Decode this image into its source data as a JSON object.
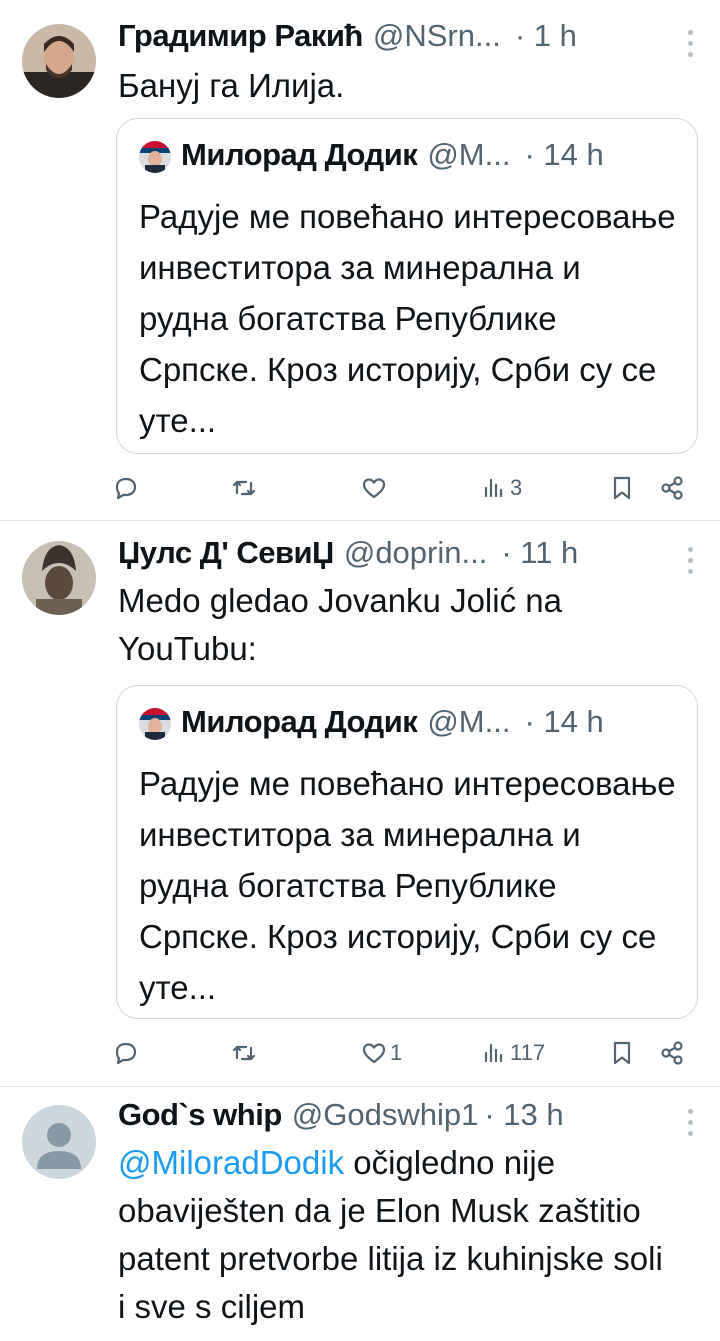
{
  "tweets": [
    {
      "name": "Градимир Ракић",
      "handle": "@NSrn...",
      "time": "· 1 h",
      "text": "Бануј га Илија.",
      "quote": {
        "name": "Милорад Додик",
        "handle": "@M...",
        "time": "· 14 h",
        "text": "Радује ме повећано интересовање инвеститора за минерална и рудна богатства Републике Српске. Кроз историју, Срби су се уте..."
      },
      "stats": {
        "replies": "",
        "retweets": "",
        "likes": "",
        "views": "3"
      }
    },
    {
      "name": "Џулс Д' СевиЏ",
      "handle": "@doprin...",
      "time": "· 11 h",
      "text": "Medo gledao Jovanku Jolić na YouTubu:",
      "quote": {
        "name": "Милорад Додик",
        "handle": "@M...",
        "time": "· 14 h",
        "text": "Радује ме повећано интересовање инвеститора за минерална и рудна богатства Републике Српске. Кроз историју, Срби су се уте..."
      },
      "stats": {
        "replies": "",
        "retweets": "",
        "likes": "1",
        "views": "117"
      }
    },
    {
      "name": "God`s whip",
      "handle": "@Godswhip1",
      "time": "· 13 h",
      "mention": "@MiloradDodik",
      "text": " očigledno nije obaviješten da je Elon Musk zaštitio patent pretvorbe litija iz kuhinjske soli i sve s ciljem"
    }
  ],
  "icons": [
    "reply-icon",
    "retweet-icon",
    "like-icon",
    "views-icon",
    "bookmark-icon",
    "share-icon",
    "more-icon"
  ],
  "colors": {
    "link": "#1d9bf0",
    "secondary": "#536471",
    "border": "#cfd9de"
  }
}
